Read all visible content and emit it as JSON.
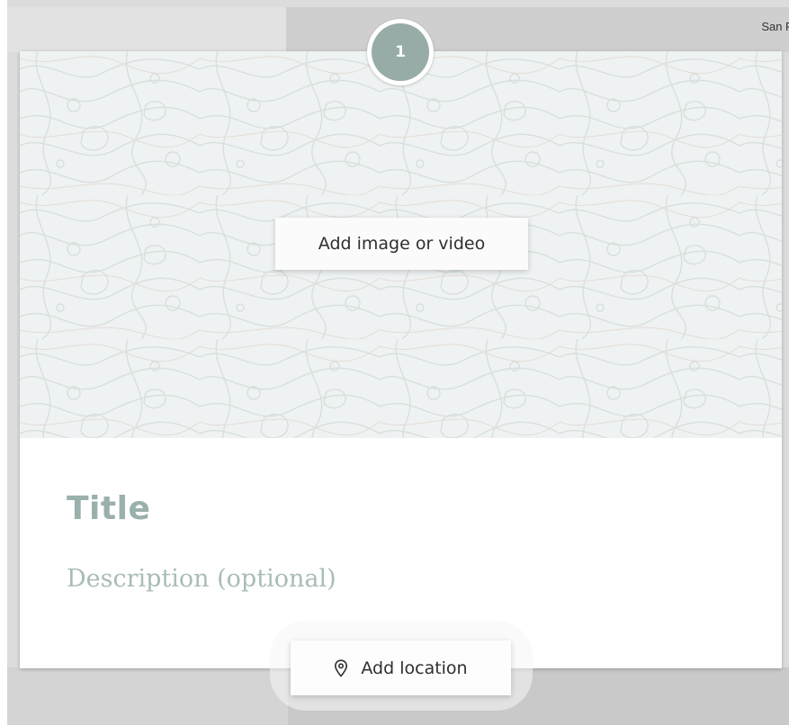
{
  "map": {
    "corner_label": "San F"
  },
  "slide": {
    "step_number": "1",
    "add_media_label": "Add image or video",
    "title_placeholder": "Title",
    "description_placeholder": "Description (optional)",
    "add_location_label": "Add location",
    "pin_icon": "map-pin-icon"
  },
  "colors": {
    "accent": "#97aca7",
    "title_text": "#9ab0ac",
    "description_text": "#a8bcb8",
    "media_background": "#eef2f2"
  }
}
